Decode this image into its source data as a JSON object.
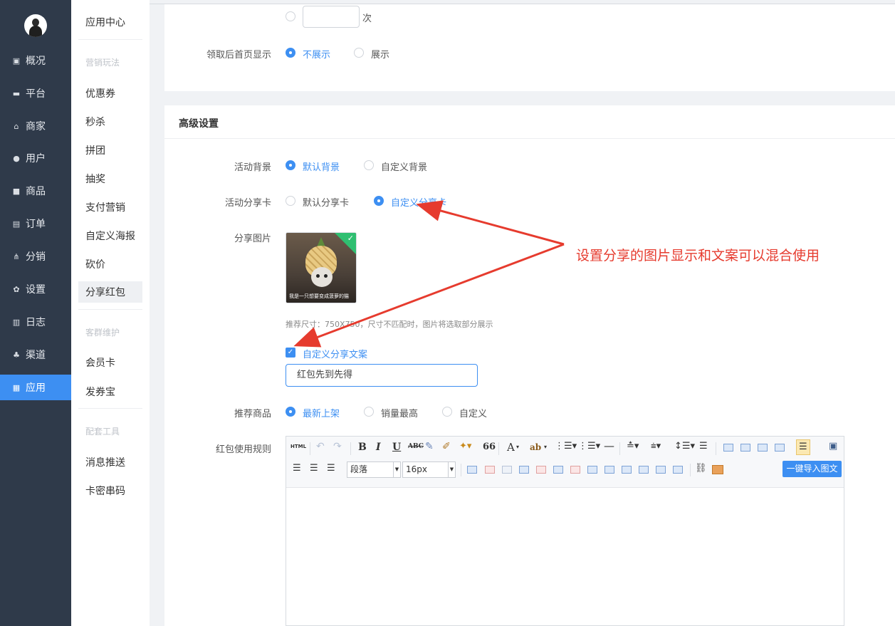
{
  "sidebar": {
    "items": [
      {
        "label": "概况",
        "icon": "dashboard-icon"
      },
      {
        "label": "平台",
        "icon": "monitor-icon"
      },
      {
        "label": "商家",
        "icon": "store-icon"
      },
      {
        "label": "用户",
        "icon": "user-icon"
      },
      {
        "label": "商品",
        "icon": "goods-icon"
      },
      {
        "label": "订单",
        "icon": "order-icon"
      },
      {
        "label": "分销",
        "icon": "distribution-icon"
      },
      {
        "label": "设置",
        "icon": "gear-icon"
      },
      {
        "label": "日志",
        "icon": "log-icon"
      },
      {
        "label": "渠道",
        "icon": "channel-icon"
      },
      {
        "label": "应用",
        "icon": "apps-icon",
        "active": true
      }
    ]
  },
  "subnav": {
    "title": "应用中心",
    "group1": "营销玩法",
    "group1_items": [
      "优惠券",
      "秒杀",
      "拼团",
      "抽奖",
      "支付营销",
      "自定义海报",
      "砍价",
      "分享红包"
    ],
    "group2": "客群维护",
    "group2_items": [
      "会员卡",
      "发券宝"
    ],
    "group3": "配套工具",
    "group3_items": [
      "消息推送",
      "卡密串码"
    ]
  },
  "top_section": {
    "count_suffix": "次",
    "homepage_label": "领取后首页显示",
    "homepage_options": [
      "不展示",
      "展示"
    ]
  },
  "advanced": {
    "title": "高级设置",
    "bg_label": "活动背景",
    "bg_options": [
      "默认背景",
      "自定义背景"
    ],
    "card_label": "活动分享卡",
    "card_options": [
      "默认分享卡",
      "自定义分享卡"
    ],
    "image_label": "分享图片",
    "image_caption": "我是一只想要变成菠萝的猫",
    "hint": "推荐尺寸：750X750，尺寸不匹配时，图片将选取部分展示",
    "custom_text_label": "自定义分享文案",
    "custom_text_value": "红包先到先得",
    "goods_label": "推荐商品",
    "goods_options": [
      "最新上架",
      "销量最高",
      "自定义"
    ],
    "rules_label": "红包使用规则"
  },
  "editor": {
    "paragraph_select": "段落",
    "font_size_select": "16px",
    "import_button": "一键导入图文",
    "html_btn": "HTML",
    "bold": "B",
    "italic": "I",
    "underline": "U",
    "strike": "ABC",
    "quote": "66",
    "font_color": "A",
    "highlight": "ab"
  },
  "annotation": {
    "text": "设置分享的图片显示和文案可以混合使用",
    "color": "#e63b2e"
  },
  "colors": {
    "accent": "#3d8ff2",
    "sidebar_bg": "#2f3a4a"
  }
}
